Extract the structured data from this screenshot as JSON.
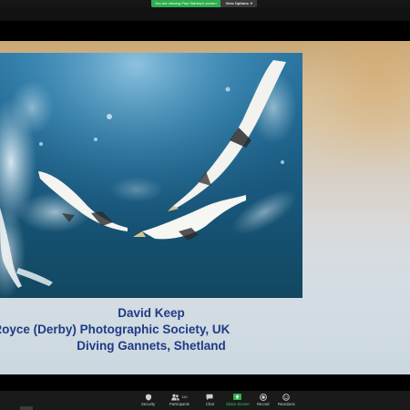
{
  "top_bar": {
    "share_banner": "You are viewing Paul Stanley's screen",
    "view_options": "View Options",
    "view_options_icon": "chevron-down-icon",
    "banner_color": "#2fae4f"
  },
  "slide": {
    "photo_description_icon": "diving-gannets-photo",
    "caption": {
      "author": "David Keep",
      "society": "Rolls Royce (Derby) Photographic Society, UK",
      "title": "Diving Gannets, Shetland"
    },
    "caption_color": "#1f3b86"
  },
  "toolbar": {
    "items": [
      {
        "label": "Security",
        "icon": "shield-icon"
      },
      {
        "label": "Participants",
        "icon": "people-icon",
        "count": "110"
      },
      {
        "label": "Chat",
        "icon": "chat-icon"
      },
      {
        "label": "Share Screen",
        "icon": "share-screen-icon"
      },
      {
        "label": "Record",
        "icon": "record-icon"
      },
      {
        "label": "Reactions",
        "icon": "smiley-icon"
      }
    ],
    "share_color": "#2fae4f"
  }
}
